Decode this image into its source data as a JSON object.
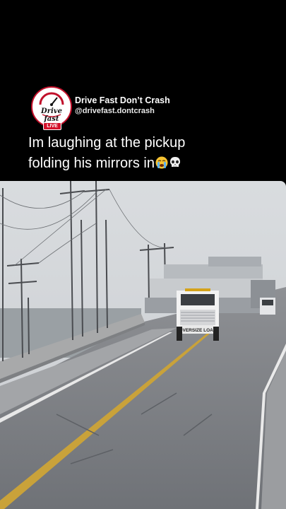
{
  "channel": {
    "name": "Drive Fast Don’t Crash",
    "handle": "@drivefast.dontcrash",
    "avatar_text": "Drive fast",
    "live_label": "LIVE",
    "accent_color": "#d3112a"
  },
  "caption": {
    "line1": "Im laughing at the pickup",
    "line2": "folding his mirrors in",
    "emojis": [
      "loudly-crying-face-icon",
      "skull-icon"
    ]
  },
  "video": {
    "truck_plate": "OVERSIZE LOAD"
  }
}
